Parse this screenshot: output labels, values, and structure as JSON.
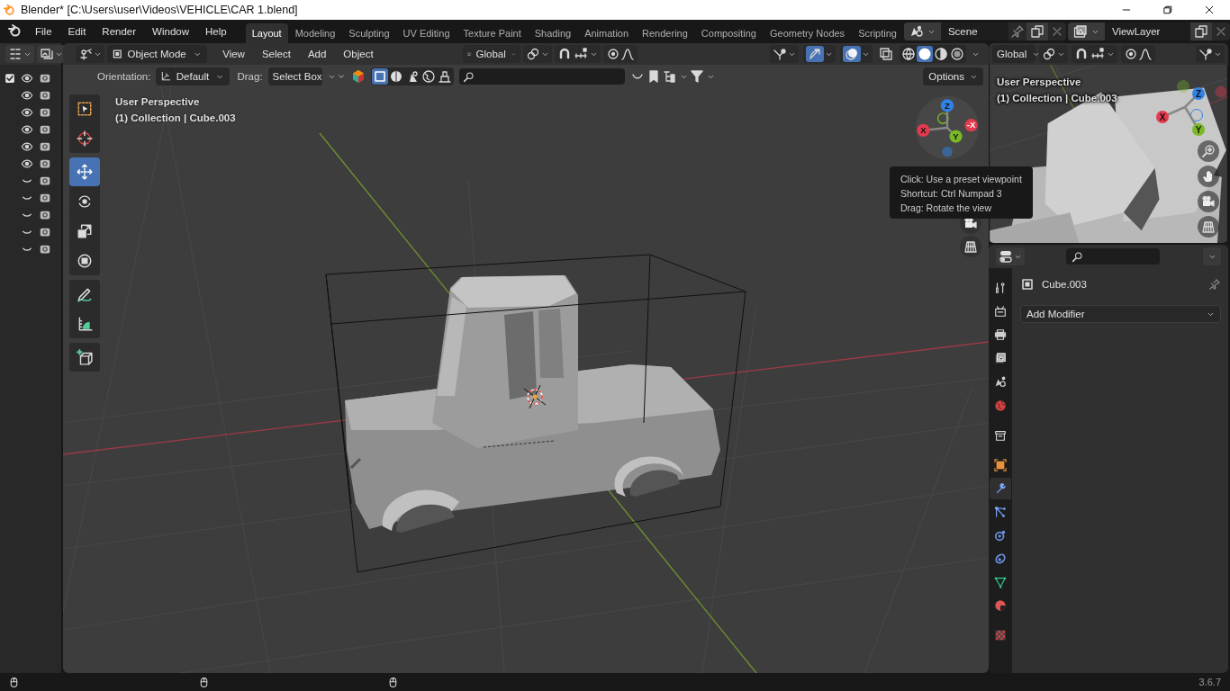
{
  "window": {
    "title": "Blender* [C:\\Users\\user\\Videos\\VEHICLE\\CAR 1.blend]"
  },
  "menu": [
    "File",
    "Edit",
    "Render",
    "Window",
    "Help"
  ],
  "workspaces": [
    {
      "label": "Layout",
      "selected": true
    },
    {
      "label": "Modeling",
      "selected": false
    },
    {
      "label": "Sculpting",
      "selected": false
    },
    {
      "label": "UV Editing",
      "selected": false
    },
    {
      "label": "Texture Paint",
      "selected": false
    },
    {
      "label": "Shading",
      "selected": false
    },
    {
      "label": "Animation",
      "selected": false
    },
    {
      "label": "Rendering",
      "selected": false
    },
    {
      "label": "Compositing",
      "selected": false
    },
    {
      "label": "Geometry Nodes",
      "selected": false
    },
    {
      "label": "Scripting",
      "selected": false
    }
  ],
  "scene": {
    "name": "Scene"
  },
  "view_layer": {
    "name": "ViewLayer"
  },
  "outliner": {
    "collection": {
      "checked": true,
      "visible": true
    },
    "rows": [
      {
        "visible": true
      },
      {
        "visible": true
      },
      {
        "visible": true
      },
      {
        "visible": true
      },
      {
        "visible": true
      },
      {
        "visible": false
      },
      {
        "visible": false
      },
      {
        "visible": false
      },
      {
        "visible": false
      },
      {
        "visible": false
      }
    ]
  },
  "viewport": {
    "mode": "Object Mode",
    "menus": [
      "View",
      "Select",
      "Add",
      "Object"
    ],
    "transform_orientation": "Global",
    "gizmos_on": true,
    "overlays_on": true,
    "xray_on": false,
    "shading": [
      {
        "selected": false
      },
      {
        "selected": true
      },
      {
        "selected": false
      },
      {
        "selected": false
      }
    ],
    "tool_settings": {
      "orientation_label": "Orientation:",
      "orientation": "Default",
      "drag_label": "Drag:",
      "drag": "Select Box",
      "options": "Options",
      "select_modes": [
        {
          "selected": true
        },
        {
          "selected": false
        },
        {
          "selected": false
        },
        {
          "selected": false
        },
        {
          "selected": false
        }
      ]
    },
    "overlay_lines": [
      "User Perspective",
      "(1) Collection | Cube.003"
    ],
    "tool_groups": [
      [
        {
          "selected": false
        },
        {
          "selected": false
        }
      ],
      [
        {
          "selected": true
        },
        {
          "selected": false
        },
        {
          "selected": false
        },
        {
          "selected": false
        }
      ],
      [
        {
          "selected": false
        },
        {
          "selected": false
        }
      ],
      [
        {
          "selected": false
        }
      ]
    ],
    "gizmo": {
      "labels": [
        "Z",
        "Y",
        "X",
        "-X"
      ]
    },
    "tooltip": [
      "Click: Use a preset viewpoint",
      "Shortcut: Ctrl Numpad 3",
      "Drag: Rotate the view"
    ]
  },
  "preview": {
    "transform_orientation": "Global",
    "overlay_lines": [
      "User Perspective",
      "(1) Collection | Cube.003"
    ],
    "gizmo": {
      "labels": [
        "Z",
        "X",
        "Y"
      ]
    }
  },
  "properties": {
    "object": "Cube.003",
    "add_modifier": "Add Modifier",
    "tabs": [
      {
        "selected": false
      },
      {
        "selected": false
      },
      {
        "selected": false
      },
      {
        "selected": false
      },
      {
        "selected": false
      },
      {
        "selected": false
      },
      {
        "selected": false
      },
      {
        "selected": false
      },
      {
        "selected": true
      },
      {
        "selected": false
      },
      {
        "selected": false
      },
      {
        "selected": false
      },
      {
        "selected": false
      },
      {
        "selected": false
      },
      {
        "selected": false
      }
    ]
  },
  "status_bar": {
    "version": "3.6.7"
  }
}
